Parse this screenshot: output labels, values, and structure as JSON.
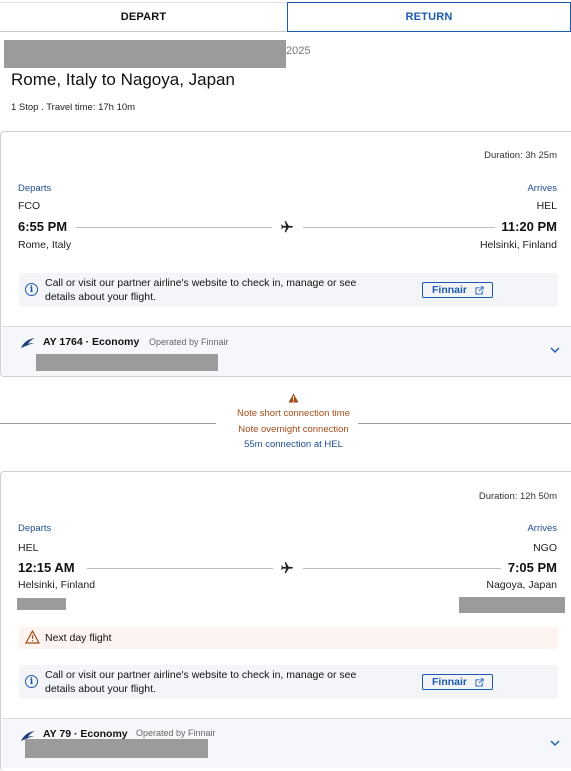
{
  "tabs": {
    "depart": "DEPART",
    "return": "RETURN"
  },
  "header": {
    "date_suffix": "2025",
    "route": "Rome, Italy to Nagoya, Japan",
    "summary": "1 Stop . Travel time: 17h 10m"
  },
  "segments": [
    {
      "duration": "Duration: 3h 25m",
      "departs_label": "Departs",
      "arrives_label": "Arrives",
      "from_code": "FCO",
      "to_code": "HEL",
      "dep_time": "6:55 PM",
      "arr_time": "11:20 PM",
      "from_city": "Rome, Italy",
      "to_city": "Helsinki, Finland",
      "partner_note": "Call or visit our partner airline's website to check in, manage or see details about your flight.",
      "partner_button": "Finnair",
      "flight": "AY 1764 · Economy",
      "operated_by": "Operated by Finnair"
    },
    {
      "duration": "Duration: 12h 50m",
      "departs_label": "Departs",
      "arrives_label": "Arrives",
      "from_code": "HEL",
      "to_code": "NGO",
      "dep_time": "12:15 AM",
      "arr_time": "7:05 PM",
      "from_city": "Helsinki, Finland",
      "to_city": "Nagoya, Japan",
      "next_day": "Next day flight",
      "partner_note": "Call or visit our partner airline's website to check in, manage or see details about your flight.",
      "partner_button": "Finnair",
      "flight": "AY 79 · Economy",
      "operated_by": "Operated by Finnair"
    }
  ],
  "connection": {
    "warning_1": "Note short connection time",
    "warning_2": "Note overnight connection",
    "info": "55m connection at HEL"
  },
  "colors": {
    "accent": "#1a5ab0",
    "warning": "#a34b18",
    "redaction": "#9b9b9b"
  },
  "icons": [
    "plane-icon",
    "info-icon",
    "external-link-icon",
    "finnair-logo-icon",
    "chevron-down-icon",
    "warning-icon"
  ]
}
